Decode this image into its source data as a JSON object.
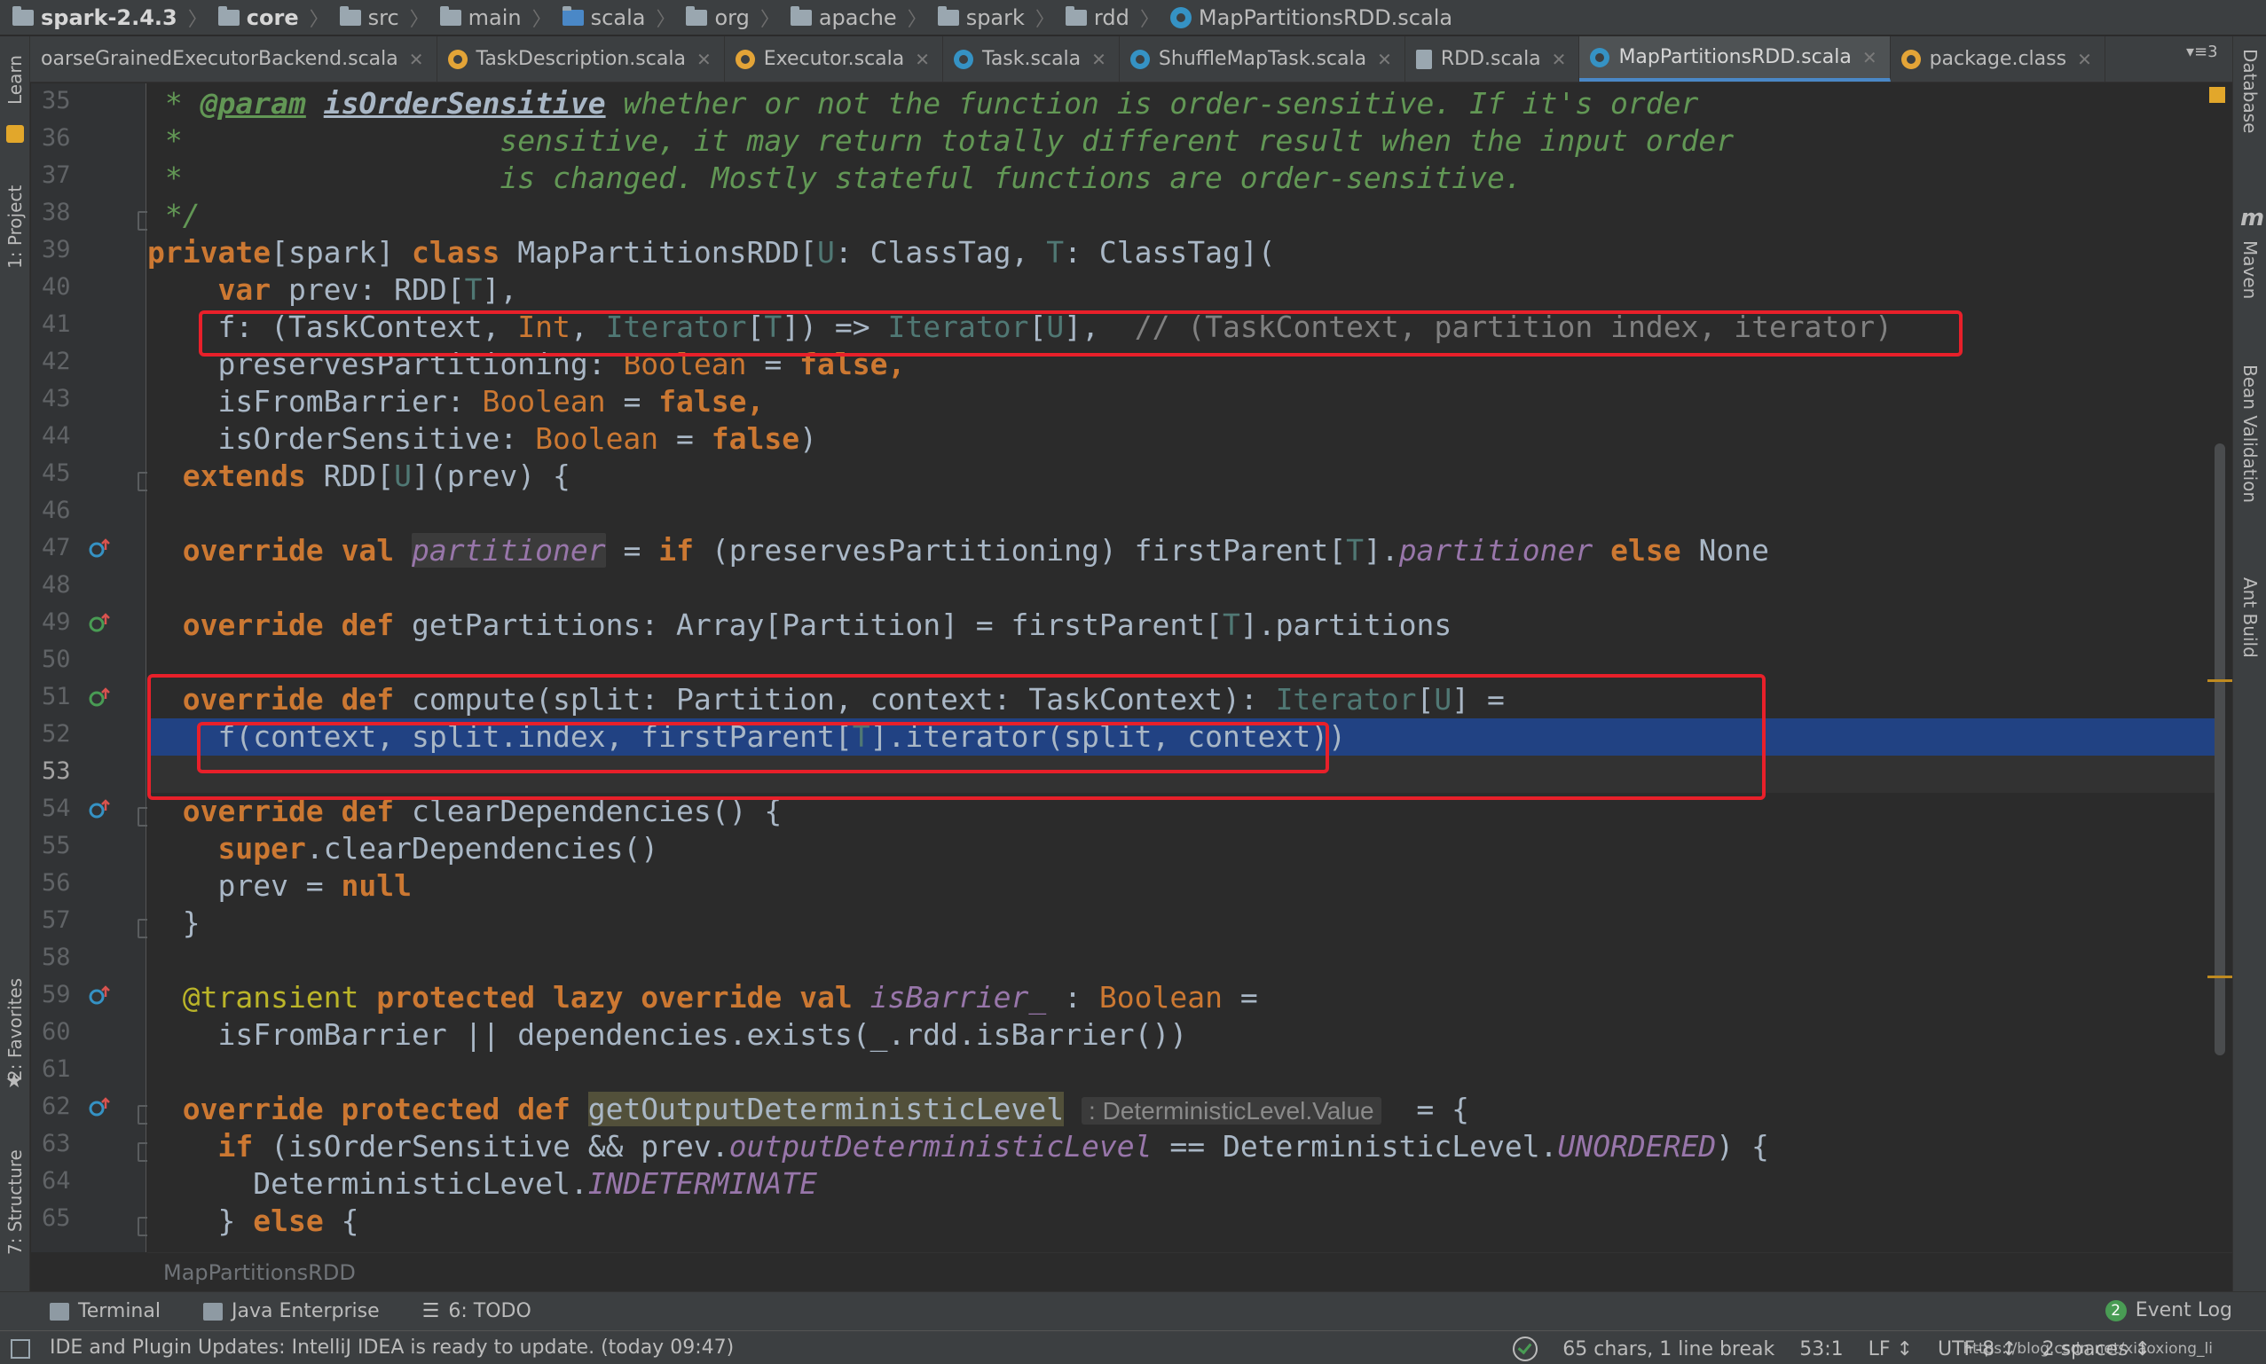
{
  "breadcrumb": {
    "items": [
      "spark-2.4.3",
      "core",
      "src",
      "main",
      "scala",
      "org",
      "apache",
      "spark",
      "rdd",
      "MapPartitionsRDD.scala"
    ]
  },
  "tabs": [
    {
      "label": "oarseGrainedExecutorBackend.scala",
      "icon": "scala-file-icon",
      "active": false
    },
    {
      "label": "TaskDescription.scala",
      "icon": "scala-file-icon",
      "active": false
    },
    {
      "label": "Executor.scala",
      "icon": "scala-file-icon",
      "active": false
    },
    {
      "label": "Task.scala",
      "icon": "scala-file-icon",
      "active": false
    },
    {
      "label": "ShuffleMapTask.scala",
      "icon": "scala-file-icon",
      "active": false
    },
    {
      "label": "RDD.scala",
      "icon": "file-icon",
      "active": false
    },
    {
      "label": "MapPartitionsRDD.scala",
      "icon": "scala-file-icon",
      "active": true
    },
    {
      "label": "package.class",
      "icon": "package-icon",
      "active": false
    }
  ],
  "tab_overflow": "▾≡3",
  "left_tools": [
    "Learn",
    "1: Project",
    "2: Favorites",
    "7: Structure"
  ],
  "right_tools": [
    "Database",
    "Maven",
    "Bean Validation",
    "Ant Build"
  ],
  "line_numbers": [
    "35",
    "36",
    "37",
    "38",
    "39",
    "40",
    "41",
    "42",
    "43",
    "44",
    "45",
    "46",
    "47",
    "48",
    "49",
    "50",
    "51",
    "52",
    "53",
    "54",
    "55",
    "56",
    "57",
    "58",
    "59",
    "60",
    "61",
    "62",
    "63",
    "64",
    "65"
  ],
  "code": {
    "l35_a": " * ",
    "l35_tag": "@param",
    "l35_sp": " ",
    "l35_param": "isOrderSensitive",
    "l35_rest": " whether or not the function is order-sensitive. If it's order",
    "l36": " *                  sensitive, it may return totally different result when the input order",
    "l37": " *                  is changed. Mostly stateful functions are order-sensitive.",
    "l38": " */",
    "l39_kw1": "private",
    "l39_a": "[spark] ",
    "l39_kw2": "class",
    "l39_b": " MapPartitionsRDD[",
    "l39_u": "U",
    "l39_c": ": ClassTag, ",
    "l39_t": "T",
    "l39_d": ": ClassTag](",
    "l40_kw": "    var",
    "l40_a": " prev: RDD[",
    "l40_t": "T",
    "l40_b": "],",
    "l41_a": "    f: (TaskContext, ",
    "l41_int": "Int",
    "l41_b": ", ",
    "l41_it1": "Iterator",
    "l41_c": "[",
    "l41_t": "T",
    "l41_d": "]) => ",
    "l41_it2": "Iterator",
    "l41_e": "[",
    "l41_u": "U",
    "l41_f": "],  ",
    "l41_cm": "// (TaskContext, partition index, iterator)",
    "l42_a": "    preservesPartitioning: ",
    "l42_ty": "Boolean",
    "l42_b": " = ",
    "l42_kw": "false",
    "l42_c": ",",
    "l43_a": "    isFromBarrier: ",
    "l43_ty": "Boolean",
    "l43_b": " = ",
    "l43_kw": "false",
    "l43_c": ",",
    "l44_a": "    isOrderSensitive: ",
    "l44_ty": "Boolean",
    "l44_b": " = ",
    "l44_kw": "false",
    "l44_c": ")",
    "l45_kw": "  extends",
    "l45_a": " RDD[",
    "l45_u": "U",
    "l45_b": "](prev) {",
    "l47_kw1": "  override",
    "l47_sp": " ",
    "l47_kw2": "val",
    "l47_sp2": " ",
    "l47_it": "partitioner",
    "l47_a": " = ",
    "l47_kw3": "if",
    "l47_b": " (preservesPartitioning) firstParent[",
    "l47_t": "T",
    "l47_c": "].",
    "l47_it2": "partitioner",
    "l47_d": " ",
    "l47_kw4": "else",
    "l47_e": " None",
    "l49_kw1": "  override",
    "l49_sp": " ",
    "l49_kw2": "def",
    "l49_a": " getPartitions: Array[Partition] = firstParent[",
    "l49_t": "T",
    "l49_b": "].partitions",
    "l51_kw1": "  override",
    "l51_sp": " ",
    "l51_kw2": "def",
    "l51_a": " compute(split: Partition, context: TaskContext): ",
    "l51_it": "Iterator",
    "l51_b": "[",
    "l51_u": "U",
    "l51_c": "] =",
    "l52_a": "    f(context, split.index, firstParent[",
    "l52_t": "T",
    "l52_b": "].iterator(split, context))",
    "l54_kw1": "  override",
    "l54_sp": " ",
    "l54_kw2": "def",
    "l54_a": " clearDependencies() {",
    "l55_kw": "    super",
    "l55_a": ".clearDependencies()",
    "l56_a": "    prev = ",
    "l56_kw": "null",
    "l57": "  }",
    "l59_an": "  @transient",
    "l59_sp": " ",
    "l59_kw": "protected lazy override val",
    "l59_sp2": " ",
    "l59_it": "isBarrier_",
    "l59_a": " : ",
    "l59_ty": "Boolean",
    "l59_b": " =",
    "l60": "    isFromBarrier || dependencies.exists(_.rdd.isBarrier())",
    "l62_kw": "  override protected def",
    "l62_sp": " ",
    "l62_fn": "getOutputDeterministicLevel",
    "l62_hint": ": DeterministicLevel.Value",
    "l62_a": "  = {",
    "l63_kw": "    if",
    "l63_a": " (isOrderSensitive && prev.",
    "l63_it": "outputDeterministicLevel",
    "l63_b": " == DeterministicLevel.",
    "l63_it2": "UNORDERED",
    "l63_c": ") {",
    "l64_a": "      DeterministicLevel.",
    "l64_it": "INDETERMINATE",
    "l65_a": "    } ",
    "l65_kw": "else",
    "l65_b": " {"
  },
  "footer_crumb": "MapPartitionsRDD",
  "tool_windows": [
    "Terminal",
    "Java Enterprise",
    "6: TODO"
  ],
  "event_log": {
    "label": "Event Log",
    "count": "2"
  },
  "status": {
    "message": "IDE and Plugin Updates: IntelliJ IDEA is ready to update. (today 09:47)",
    "selection": "65 chars, 1 line break",
    "position": "53:1",
    "line_sep": "LF ↕",
    "encoding": "UTF-8 ↕",
    "indent": "2 spaces ↕",
    "watermark": "https://blog.csdn.net/xiaoxiong_li"
  }
}
